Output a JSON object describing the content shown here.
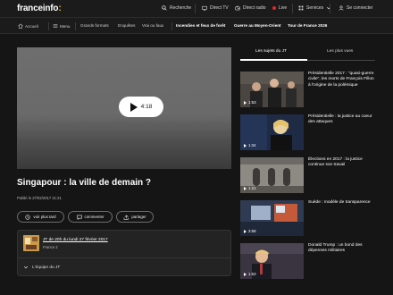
{
  "header": {
    "logo": "franceinfo",
    "logo_dot": ":",
    "search": "Recherche",
    "direct_tv": "Direct TV",
    "direct_radio": "Direct radio",
    "live": "Live",
    "services": "Services",
    "login": "Se connecter"
  },
  "nav": {
    "home": "Accueil",
    "menu": "Menu",
    "items": [
      "Grands formats",
      "Enquêtes",
      "Vrai ou faux"
    ],
    "highlights": [
      "Incendies et feux de forêt",
      "Guerre au Moyen-Orient",
      "Tour de France 2026"
    ]
  },
  "video": {
    "duration": "4:18",
    "title": "Singapour : la ville de demain ?",
    "published": "Publié le 27/02/2017 21:21"
  },
  "actions": {
    "watch_later": "voir plus tard",
    "comment": "commenter",
    "share": "partager"
  },
  "program": {
    "link": "JT de 20h du lundi 27 février 2017",
    "channel": "France 2",
    "team_toggle": "L'équipe du JT"
  },
  "sidebar": {
    "tabs": [
      "Les sujets du JT",
      "Les plus vues"
    ],
    "items": [
      {
        "title": "Présidentielle 2017 : \"quasi-guerre civile\", les morts de François Fillon à l'origine de la polémique",
        "duration": "1:53"
      },
      {
        "title": "Présidentielle : la justice au coeur des attaques",
        "duration": "1:34"
      },
      {
        "title": "Élections en 2017 : la justice continue son travail",
        "duration": "1:21"
      },
      {
        "title": "Suède : modèle de transparence",
        "duration": "3:58"
      },
      {
        "title": "Donald Trump : un bond des dépenses militaires",
        "duration": "1:53"
      }
    ]
  },
  "colors": {
    "background": "#151515",
    "brand_dot": "#f5c400",
    "live": "#e8242b"
  }
}
